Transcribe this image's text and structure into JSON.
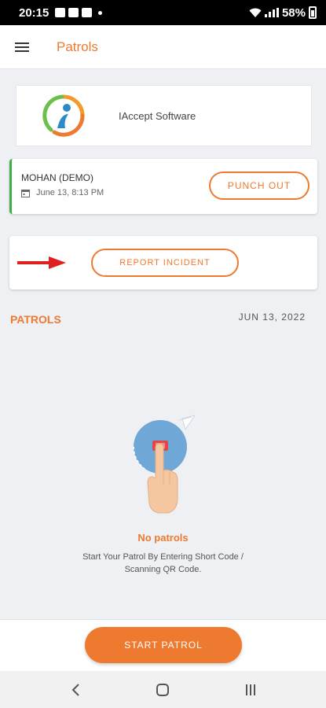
{
  "status_bar": {
    "time": "20:15",
    "battery": "58%"
  },
  "app_bar": {
    "title": "Patrols"
  },
  "company": {
    "name": "IAccept Software"
  },
  "user": {
    "name": "MOHAN (DEMO)",
    "time": "June 13, 8:13 PM",
    "punch_label": "PUNCH OUT"
  },
  "incident": {
    "label": "REPORT INCIDENT"
  },
  "patrols": {
    "heading": "PATROLS",
    "date": "JUN 13, 2022"
  },
  "empty_state": {
    "title": "No patrols",
    "description": "Start Your Patrol By Entering Short Code / Scanning QR Code."
  },
  "actions": {
    "start_label": "START PATROL"
  },
  "colors": {
    "accent": "#ee7a2f",
    "active_border": "#3fae49",
    "arrow": "#e02020"
  }
}
